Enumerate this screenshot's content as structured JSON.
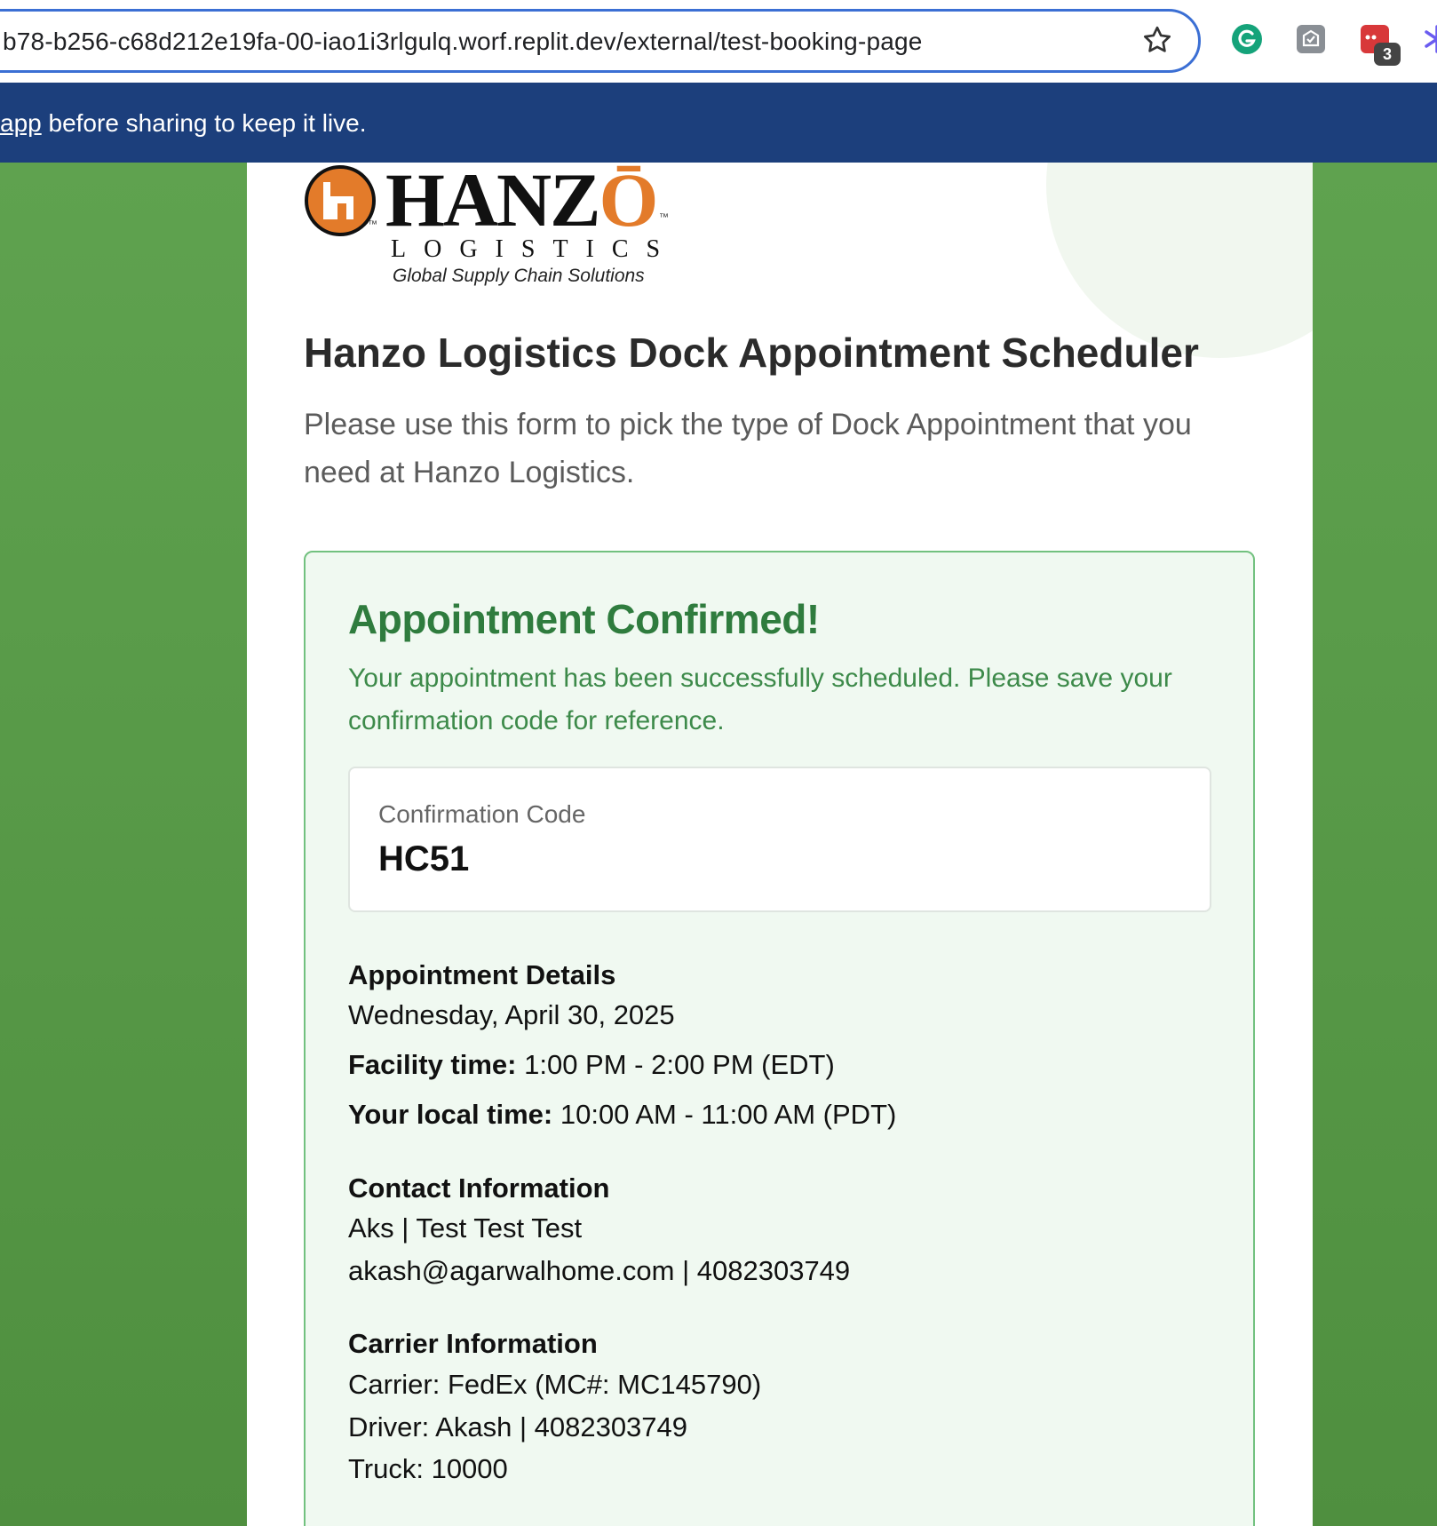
{
  "browser": {
    "url": "b78-b256-c68d212e19fa-00-iao1i3rlgulq.worf.replit.dev/external/test-booking-page",
    "extension_badge": "3",
    "icons": [
      "star-icon",
      "grammarly-icon",
      "mail-extension-icon",
      "red-extension-icon",
      "purple-extension-icon"
    ]
  },
  "notice": {
    "link": "app",
    "text": " before sharing to keep it live."
  },
  "logo": {
    "word_start": "HANZ",
    "word_end": "Ō",
    "sub": "LOGISTICS",
    "tagline": "Global Supply Chain Solutions",
    "tm": "™"
  },
  "header": {
    "title": "Hanzo Logistics Dock Appointment Scheduler",
    "description": "Please use this form to pick the type of Dock Appointment that you need at Hanzo Logistics."
  },
  "confirmation": {
    "title": "Appointment Confirmed!",
    "message": "Your appointment has been successfully scheduled. Please save your confirmation code for reference.",
    "code_label": "Confirmation Code",
    "code_value": "HC51"
  },
  "appointment": {
    "heading": "Appointment Details",
    "date": "Wednesday, April 30, 2025",
    "facility_label": "Facility time:",
    "facility_value": " 1:00 PM - 2:00 PM (EDT)",
    "local_label": "Your local time:",
    "local_value": " 10:00 AM - 11:00 AM (PDT)"
  },
  "contact": {
    "heading": "Contact Information",
    "line1": "Aks | Test Test Test",
    "line2": "akash@agarwalhome.com | 4082303749"
  },
  "carrier": {
    "heading": "Carrier Information",
    "carrier": "Carrier: FedEx (MC#: MC145790)",
    "driver": "Driver: Akash | 4082303749",
    "truck": "Truck: 10000"
  },
  "colors": {
    "banner": "#1c3f7c",
    "page_green": "#5fa24f",
    "success_green": "#2f7c3e",
    "logo_orange": "#e37b2a"
  }
}
